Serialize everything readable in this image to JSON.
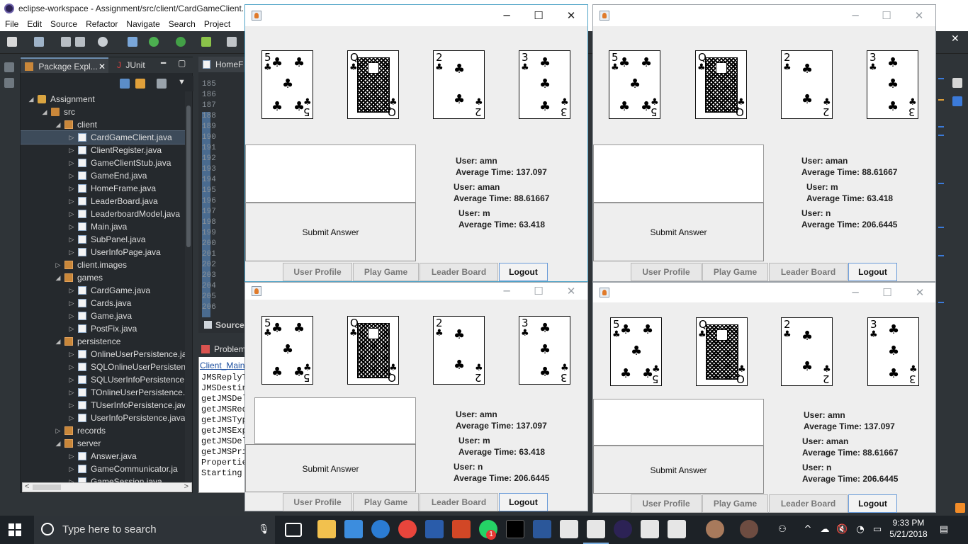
{
  "eclipse": {
    "title": "eclipse-workspace - Assignment/src/client/CardGameClient.",
    "menu": [
      "File",
      "Edit",
      "Source",
      "Refactor",
      "Navigate",
      "Search",
      "Project"
    ],
    "package_explorer_tab": "Package Expl...",
    "junit_tab": "JUnit",
    "editor_tab": "HomeF",
    "line_numbers": [
      "185",
      "186",
      "187",
      "188",
      "189",
      "190",
      "191",
      "192",
      "193",
      "194",
      "195",
      "196",
      "197",
      "198",
      "199",
      "200",
      "201",
      "202",
      "203",
      "204",
      "205",
      "206"
    ],
    "source_tab": "Source",
    "problems_tab": "Problem",
    "console_header": "Client_Main",
    "console_lines": [
      "JMSReplyT",
      "JMSDestin",
      "getJMSDel",
      "getJMSRed",
      "getJMSTyp",
      "getJMSExp",
      "getJMSDel",
      "getJMSPri",
      "Propertie",
      "Starting"
    ],
    "tree": [
      {
        "label": "Assignment",
        "indent": 0,
        "icon": "project-icon",
        "twisty": "expanded"
      },
      {
        "label": "src",
        "indent": 1,
        "icon": "source-folder-icon",
        "twisty": "expanded"
      },
      {
        "label": "client",
        "indent": 2,
        "icon": "package-icon",
        "twisty": "expanded"
      },
      {
        "label": "CardGameClient.java",
        "indent": 3,
        "icon": "java-file-icon",
        "twisty": "collapsed",
        "selected": true
      },
      {
        "label": "ClientRegister.java",
        "indent": 3,
        "icon": "java-file-icon",
        "twisty": "collapsed"
      },
      {
        "label": "GameClientStub.java",
        "indent": 3,
        "icon": "java-file-icon",
        "twisty": "collapsed"
      },
      {
        "label": "GameEnd.java",
        "indent": 3,
        "icon": "java-file-icon",
        "twisty": "collapsed"
      },
      {
        "label": "HomeFrame.java",
        "indent": 3,
        "icon": "java-file-icon",
        "twisty": "collapsed"
      },
      {
        "label": "LeaderBoard.java",
        "indent": 3,
        "icon": "java-file-icon",
        "twisty": "collapsed"
      },
      {
        "label": "LeaderboardModel.java",
        "indent": 3,
        "icon": "java-file-icon",
        "twisty": "collapsed"
      },
      {
        "label": "Main.java",
        "indent": 3,
        "icon": "java-file-icon",
        "twisty": "collapsed"
      },
      {
        "label": "SubPanel.java",
        "indent": 3,
        "icon": "java-file-icon",
        "twisty": "collapsed"
      },
      {
        "label": "UserInfoPage.java",
        "indent": 3,
        "icon": "java-file-icon",
        "twisty": "collapsed"
      },
      {
        "label": "client.images",
        "indent": 2,
        "icon": "folder-icon",
        "twisty": "collapsed"
      },
      {
        "label": "games",
        "indent": 2,
        "icon": "package-icon",
        "twisty": "expanded"
      },
      {
        "label": "CardGame.java",
        "indent": 3,
        "icon": "java-file-icon",
        "twisty": "collapsed"
      },
      {
        "label": "Cards.java",
        "indent": 3,
        "icon": "java-file-icon",
        "twisty": "collapsed"
      },
      {
        "label": "Game.java",
        "indent": 3,
        "icon": "java-file-icon",
        "twisty": "collapsed"
      },
      {
        "label": "PostFix.java",
        "indent": 3,
        "icon": "java-file-icon",
        "twisty": "collapsed"
      },
      {
        "label": "persistence",
        "indent": 2,
        "icon": "package-icon",
        "twisty": "expanded"
      },
      {
        "label": "OnlineUserPersistence.ja",
        "indent": 3,
        "icon": "java-file-icon",
        "twisty": "collapsed"
      },
      {
        "label": "SQLOnlineUserPersisten",
        "indent": 3,
        "icon": "java-file-icon",
        "twisty": "collapsed"
      },
      {
        "label": "SQLUserInfoPersistence.",
        "indent": 3,
        "icon": "java-file-icon",
        "twisty": "collapsed"
      },
      {
        "label": "TOnlineUserPersistence.",
        "indent": 3,
        "icon": "java-file-icon",
        "twisty": "collapsed"
      },
      {
        "label": "TUserInfoPersistence.jav",
        "indent": 3,
        "icon": "java-file-icon",
        "twisty": "collapsed"
      },
      {
        "label": "UserInfoPersistence.java",
        "indent": 3,
        "icon": "java-file-icon",
        "twisty": "collapsed"
      },
      {
        "label": "records",
        "indent": 2,
        "icon": "package-icon",
        "twisty": "collapsed"
      },
      {
        "label": "server",
        "indent": 2,
        "icon": "package-icon",
        "twisty": "expanded"
      },
      {
        "label": "Answer.java",
        "indent": 3,
        "icon": "java-file-icon",
        "twisty": "collapsed"
      },
      {
        "label": "GameCommunicator.ja",
        "indent": 3,
        "icon": "java-file-icon",
        "twisty": "collapsed"
      },
      {
        "label": "GameSession.java",
        "indent": 3,
        "icon": "java-file-icon",
        "twisty": "collapsed"
      }
    ]
  },
  "client_windows": [
    {
      "cards": [
        {
          "rank": "5",
          "suit": "♣"
        },
        {
          "rank": "Q",
          "suit": "♣"
        },
        {
          "rank": "2",
          "suit": "♣"
        },
        {
          "rank": "3",
          "suit": "♣"
        }
      ],
      "submit_label": "Submit Answer",
      "users": [
        {
          "user": "User: amn",
          "time": "Average Time: 137.097"
        },
        {
          "user": "User: aman",
          "time": "Average Time: 88.61667"
        },
        {
          "user": "User: m",
          "time": "Average Time: 63.418"
        }
      ],
      "nav": [
        "User Profile",
        "Play Game",
        "Leader Board",
        "Logout"
      ]
    },
    {
      "cards": [
        {
          "rank": "5",
          "suit": "♣"
        },
        {
          "rank": "Q",
          "suit": "♣"
        },
        {
          "rank": "2",
          "suit": "♣"
        },
        {
          "rank": "3",
          "suit": "♣"
        }
      ],
      "submit_label": "Submit Answer",
      "users": [
        {
          "user": "User: aman",
          "time": "Average Time: 88.61667"
        },
        {
          "user": "User: m",
          "time": "Average Time: 63.418"
        },
        {
          "user": "User: n",
          "time": "Average Time: 206.6445"
        }
      ],
      "nav": [
        "User Profile",
        "Play Game",
        "Leader Board",
        "Logout"
      ]
    },
    {
      "cards": [
        {
          "rank": "5",
          "suit": "♣"
        },
        {
          "rank": "Q",
          "suit": "♣"
        },
        {
          "rank": "2",
          "suit": "♣"
        },
        {
          "rank": "3",
          "suit": "♣"
        }
      ],
      "submit_label": "Submit Answer",
      "users": [
        {
          "user": "User: amn",
          "time": "Average Time: 137.097"
        },
        {
          "user": "User: m",
          "time": "Average Time: 63.418"
        },
        {
          "user": "User: n",
          "time": "Average Time: 206.6445"
        }
      ],
      "nav": [
        "User Profile",
        "Play Game",
        "Leader Board",
        "Logout"
      ]
    },
    {
      "cards": [
        {
          "rank": "5",
          "suit": "♣"
        },
        {
          "rank": "Q",
          "suit": "♣"
        },
        {
          "rank": "2",
          "suit": "♣"
        },
        {
          "rank": "3",
          "suit": "♣"
        }
      ],
      "submit_label": "Submit Answer",
      "users": [
        {
          "user": "User: amn",
          "time": "Average Time: 137.097"
        },
        {
          "user": "User: aman",
          "time": "Average Time: 88.61667"
        },
        {
          "user": "User: n",
          "time": "Average Time: 206.6445"
        }
      ],
      "nav": [
        "User Profile",
        "Play Game",
        "Leader Board",
        "Logout"
      ]
    }
  ],
  "taskbar": {
    "search_placeholder": "Type here to search",
    "time": "9:33 PM",
    "date": "5/21/2018",
    "notification_badge": "1"
  }
}
